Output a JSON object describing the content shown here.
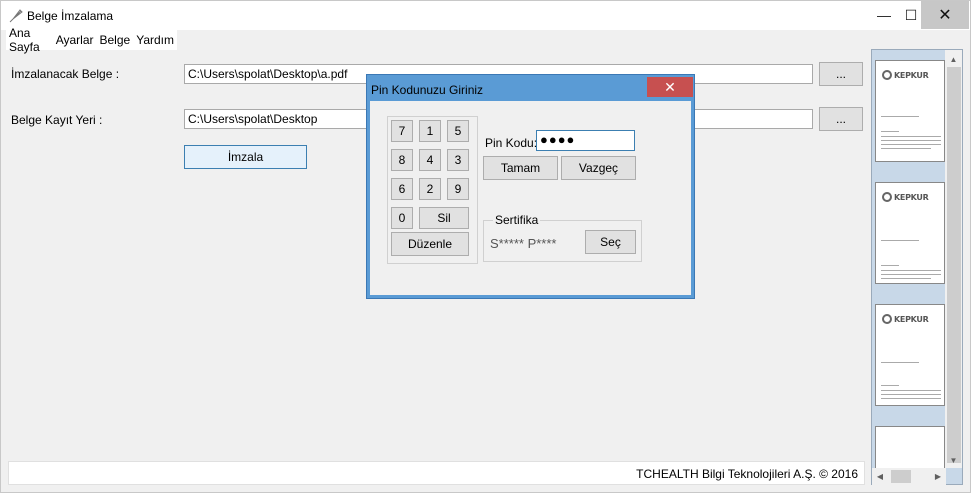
{
  "window": {
    "title": "Belge İmzalama",
    "minimize": "—",
    "maximize": "☐",
    "close": "✕"
  },
  "menu": [
    "Ana Sayfa",
    "Ayarlar",
    "Belge",
    "Yardım"
  ],
  "form": {
    "document_label": "İmzalanacak Belge :",
    "document_path": "C:\\Users\\spolat\\Desktop\\a.pdf",
    "browse_label": "...",
    "save_label": "Belge Kayıt Yeri :",
    "save_path": "C:\\Users\\spolat\\Desktop",
    "browse_label_2": "...",
    "sign_button": "İmzala"
  },
  "status": {
    "text": "TCHEALTH Bilgi Teknolojileri A.Ş. ©  2016"
  },
  "preview": {
    "logo_text": "KEPKUR",
    "page_count_visible": 4
  },
  "dialog": {
    "title": "Pin Kodunuzu Giriniz",
    "close": "✕",
    "keys": [
      "7",
      "1",
      "5",
      "8",
      "4",
      "3",
      "6",
      "2",
      "9",
      "0"
    ],
    "delete_key": "Sil",
    "shuffle_key": "Düzenle",
    "pin_label": "Pin Kodu:",
    "pin_value": "●●●●",
    "ok_button": "Tamam",
    "cancel_button": "Vazgeç",
    "cert_group": "Sertifika",
    "cert_name": "S***** P****",
    "cert_select": "Seç"
  }
}
